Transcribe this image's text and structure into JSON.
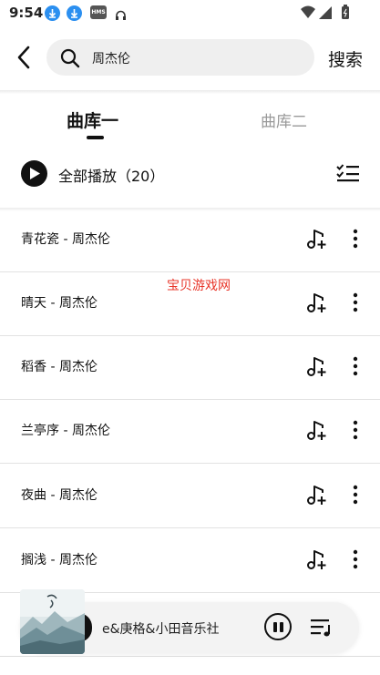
{
  "status_bar": {
    "time": "9:54",
    "hms_badge": "HMS",
    "icons": [
      "download-icon",
      "download-icon",
      "hms-icon",
      "headphones-icon",
      "wifi-icon",
      "signal-icon",
      "battery-icon"
    ]
  },
  "header": {
    "back_icon": "chevron-left-icon",
    "search_icon": "search-icon",
    "search_value": "周杰伦",
    "search_button": "搜索"
  },
  "tabs": [
    {
      "label": "曲库一",
      "active": true
    },
    {
      "label": "曲库二",
      "active": false
    }
  ],
  "play_all": {
    "label": "全部播放（20）",
    "icon": "play-icon",
    "list_select_icon": "list-select-icon"
  },
  "songs": [
    {
      "title": "青花瓷 - 周杰伦"
    },
    {
      "title": "晴天 - 周杰伦"
    },
    {
      "title": "稻香 - 周杰伦"
    },
    {
      "title": "兰亭序 - 周杰伦"
    },
    {
      "title": "夜曲 - 周杰伦"
    },
    {
      "title": "搁浅 - 周杰伦"
    }
  ],
  "watermark": "宝贝游戏网",
  "mini_player": {
    "track": "e&庚格&小田音乐社",
    "pause_icon": "pause-icon",
    "queue_icon": "playlist-icon"
  },
  "colors": {
    "accent": "#111111",
    "search_bg": "#efefef",
    "watermark": "#e8362a",
    "download_badge": "#2b8ff0"
  }
}
